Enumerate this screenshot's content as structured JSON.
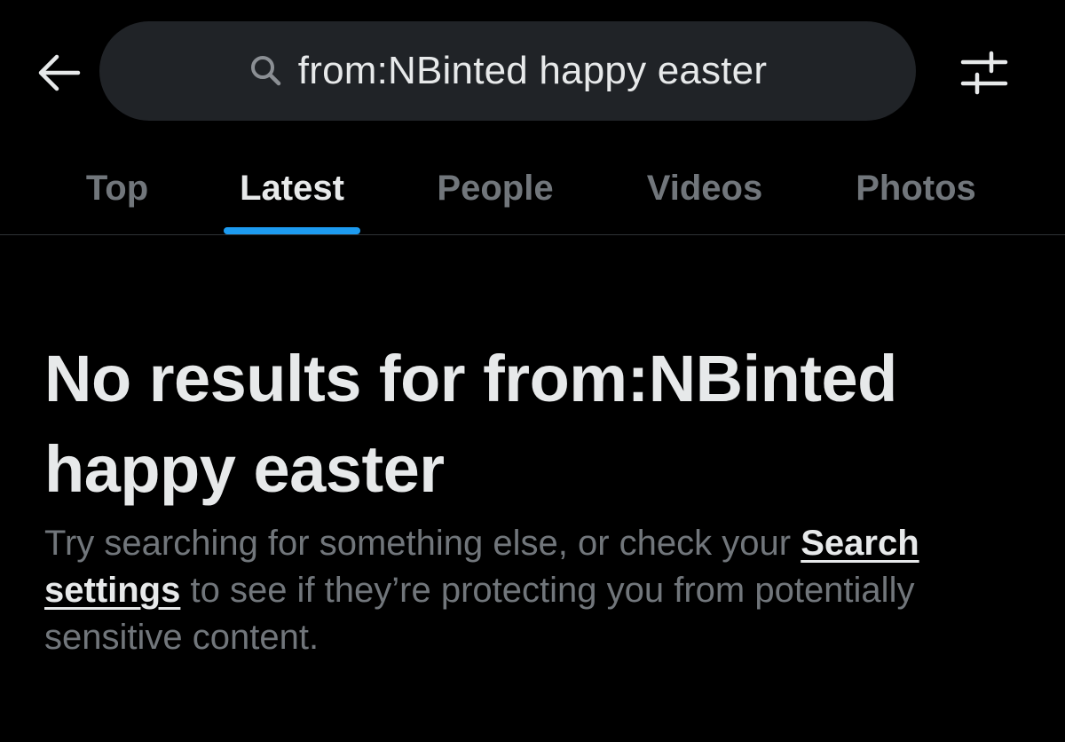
{
  "header": {
    "back_icon": "arrow-left-icon",
    "search_icon": "search-icon",
    "search_query": "from:NBinted happy easter",
    "filter_icon": "sliders-icon"
  },
  "tabs": [
    {
      "label": "Top",
      "active": false
    },
    {
      "label": "Latest",
      "active": true
    },
    {
      "label": "People",
      "active": false
    },
    {
      "label": "Videos",
      "active": false
    },
    {
      "label": "Photos",
      "active": false
    }
  ],
  "empty_state": {
    "title": "No results for from:NBinted happy easter",
    "body_before_link": "Try searching for something else, or check your ",
    "link_label": "Search settings",
    "body_after_link": " to see if they’re protecting you from potentially sensitive content."
  },
  "colors": {
    "background": "#000000",
    "accent": "#1d9bf0",
    "primary_text": "#e7e9ea",
    "secondary_text": "#71767b",
    "search_background": "#202327"
  }
}
